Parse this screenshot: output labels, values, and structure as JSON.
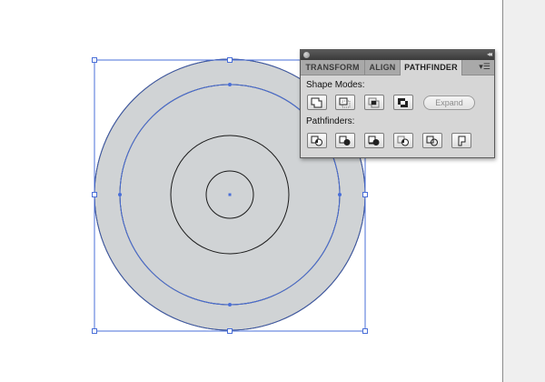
{
  "panel": {
    "tabs": [
      {
        "label": "TRANSFORM",
        "active": false
      },
      {
        "label": "ALIGN",
        "active": false
      },
      {
        "label": "PATHFINDER",
        "active": true
      }
    ],
    "collapse_glyph": "◂◂",
    "menu_glyph": "▾☰",
    "shape_modes_label": "Shape Modes:",
    "shape_modes": [
      "unite-icon",
      "minus-front-icon",
      "intersect-icon",
      "exclude-icon"
    ],
    "expand_label": "Expand",
    "pathfinders_label": "Pathfinders:",
    "pathfinders": [
      "divide-icon",
      "trim-icon",
      "merge-icon",
      "crop-icon",
      "outline-icon",
      "minus-back-icon"
    ]
  },
  "colors": {
    "selection": "#4a6fd8",
    "fill": "#d0d3d5",
    "stroke": "#1a1a1a",
    "panel_bg": "#d6d6d6"
  }
}
